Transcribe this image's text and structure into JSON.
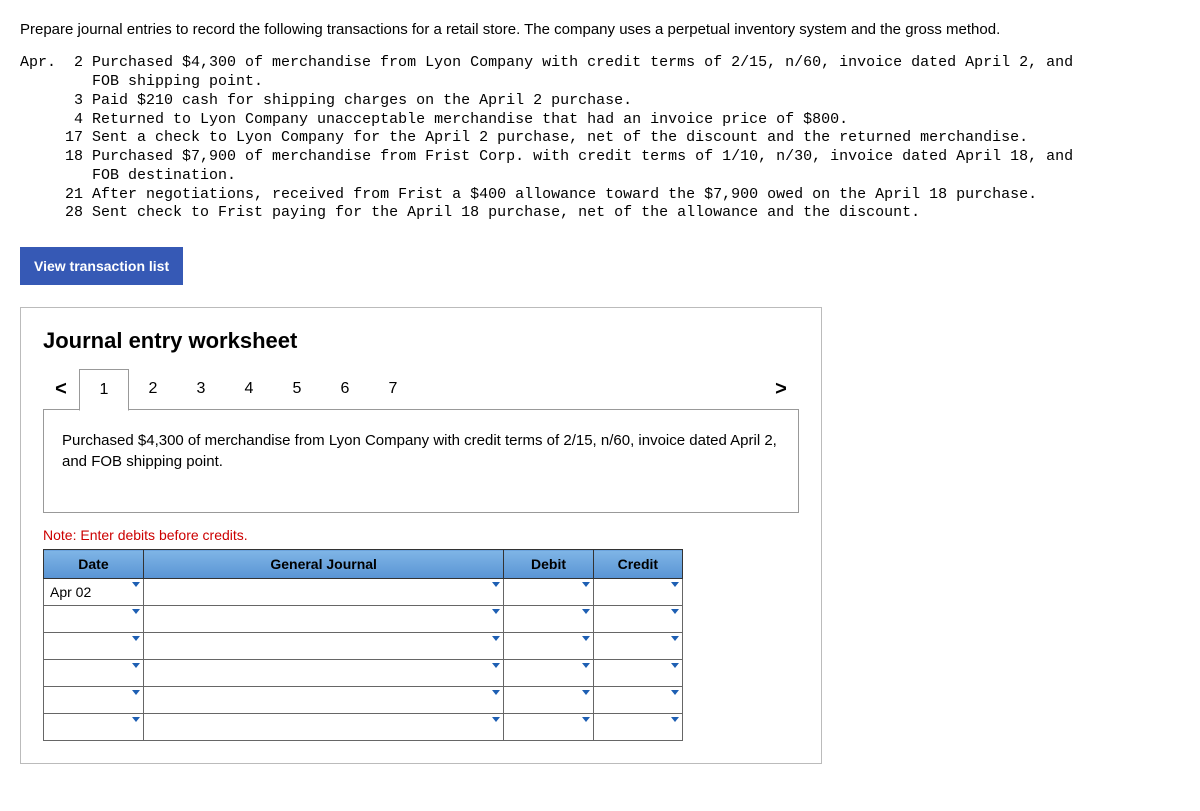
{
  "instructions": "Prepare journal entries to record the following transactions for a retail store. The company uses a perpetual inventory system and the gross method.",
  "month_label": "Apr.",
  "transactions": [
    {
      "day": "2",
      "desc": "Purchased $4,300 of merchandise from Lyon Company with credit terms of 2/15, n/60, invoice dated April 2, and FOB shipping point."
    },
    {
      "day": "3",
      "desc": "Paid $210 cash for shipping charges on the April 2 purchase."
    },
    {
      "day": "4",
      "desc": "Returned to Lyon Company unacceptable merchandise that had an invoice price of $800."
    },
    {
      "day": "17",
      "desc": "Sent a check to Lyon Company for the April 2 purchase, net of the discount and the returned merchandise."
    },
    {
      "day": "18",
      "desc": "Purchased $7,900 of merchandise from Frist Corp. with credit terms of 1/10, n/30, invoice dated April 18, and FOB destination."
    },
    {
      "day": "21",
      "desc": "After negotiations, received from Frist a $400 allowance toward the $7,900 owed on the April 18 purchase."
    },
    {
      "day": "28",
      "desc": "Sent check to Frist paying for the April 18 purchase, net of the allowance and the discount."
    }
  ],
  "view_button": "View transaction list",
  "worksheet_title": "Journal entry worksheet",
  "tabs": [
    "1",
    "2",
    "3",
    "4",
    "5",
    "6",
    "7"
  ],
  "nav_prev": "<",
  "nav_next": ">",
  "current_transaction_text": "Purchased $4,300 of merchandise from Lyon Company with credit terms of 2/15, n/60, invoice dated April 2, and FOB shipping point.",
  "note": "Note: Enter debits before credits.",
  "table": {
    "headers": {
      "date": "Date",
      "gj": "General Journal",
      "debit": "Debit",
      "credit": "Credit"
    },
    "first_date": "Apr 02"
  }
}
